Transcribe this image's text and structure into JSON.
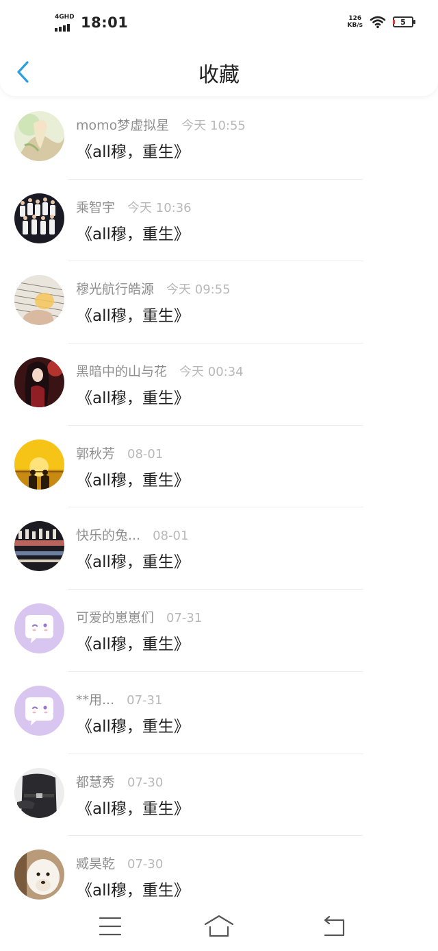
{
  "status_bar": {
    "network": "4GHD",
    "time": "18:01",
    "speed_value": "126",
    "speed_unit": "KB/s",
    "battery": "5"
  },
  "header": {
    "title": "收藏",
    "back_icon": "chevron-left-icon"
  },
  "colors": {
    "accent": "#2a9fe0",
    "meta_text": "#8f8f8f",
    "time_text": "#b8b8b8",
    "title_text": "#1f1f1f",
    "default_avatar_bg": "#d9c6f0"
  },
  "favorites": [
    {
      "user": "momo梦虚拟星",
      "time": "今天 10:55",
      "title": "《all穆，重生》"
    },
    {
      "user": "乘智宇",
      "time": "今天 10:36",
      "title": "《all穆，重生》"
    },
    {
      "user": "穆光航行皓源",
      "time": "今天 09:55",
      "title": "《all穆，重生》"
    },
    {
      "user": "黑暗中的山与花",
      "time": "今天 00:34",
      "title": "《all穆，重生》"
    },
    {
      "user": "郭秋芳",
      "time": "08-01",
      "title": "《all穆，重生》"
    },
    {
      "user": "快乐的兔...",
      "time": "08-01",
      "title": "《all穆，重生》"
    },
    {
      "user": "可爱的崽崽们",
      "time": "07-31",
      "title": "《all穆，重生》"
    },
    {
      "user": "**用...",
      "time": "07-31",
      "title": "《all穆，重生》"
    },
    {
      "user": "都慧秀",
      "time": "07-30",
      "title": "《all穆，重生》"
    },
    {
      "user": "臧昊乾",
      "time": "07-30",
      "title": "《all穆，重生》"
    }
  ],
  "bottom_nav": {
    "menu_icon": "menu-icon",
    "home_icon": "home-icon",
    "back_icon": "return-icon"
  }
}
